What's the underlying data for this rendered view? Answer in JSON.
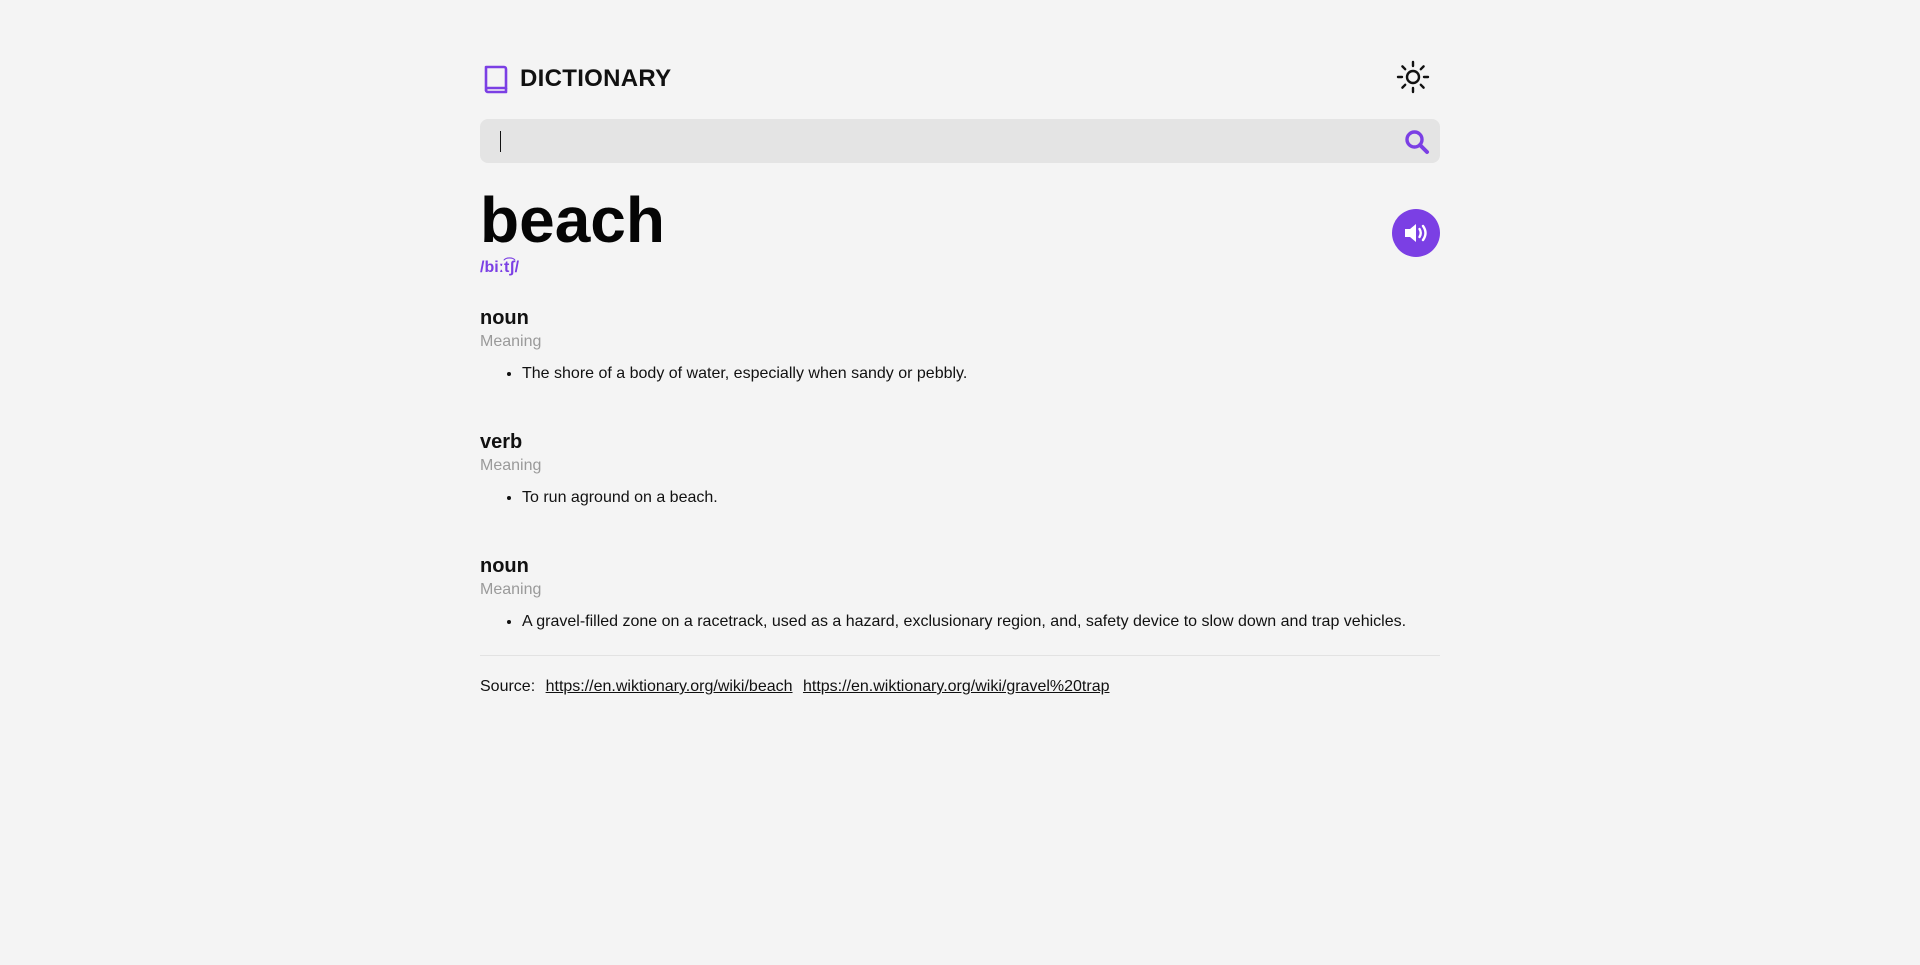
{
  "header": {
    "logo_text": "DICTIONARY",
    "logo_icon": "book-icon",
    "theme_icon": "sun-icon"
  },
  "search": {
    "value": "",
    "placeholder": "",
    "icon": "search-icon"
  },
  "entry": {
    "word": "beach",
    "phonetic": "/biːt͡ʃ/",
    "audio_icon": "speaker-icon"
  },
  "meanings": [
    {
      "part_of_speech": "noun",
      "label": "Meaning",
      "definitions": [
        "The shore of a body of water, especially when sandy or pebbly."
      ]
    },
    {
      "part_of_speech": "verb",
      "label": "Meaning",
      "definitions": [
        "To run aground on a beach."
      ]
    },
    {
      "part_of_speech": "noun",
      "label": "Meaning",
      "definitions": [
        "A gravel-filled zone on a racetrack, used as a hazard, exclusionary region, and, safety device to slow down and trap vehicles."
      ]
    }
  ],
  "source": {
    "label": "Source:",
    "links": [
      "https://en.wiktionary.org/wiki/beach",
      "https://en.wiktionary.org/wiki/gravel%20trap"
    ]
  },
  "colors": {
    "accent": "#7b3fe4",
    "background": "#f4f4f4",
    "search_bg": "#e4e4e4",
    "muted_text": "#9a9a9a"
  }
}
